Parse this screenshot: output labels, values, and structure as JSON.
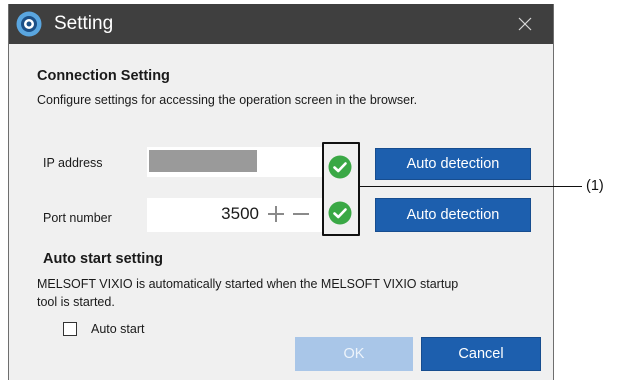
{
  "window": {
    "title": "Setting"
  },
  "connection": {
    "heading": "Connection Setting",
    "description": "Configure settings for accessing the operation screen in the browser.",
    "ip": {
      "label": "IP address",
      "value": "",
      "status_icon": "check-circle-icon",
      "button": "Auto detection"
    },
    "port": {
      "label": "Port number",
      "value": "3500",
      "plus": "+",
      "minus": "−",
      "status_icon": "check-circle-icon",
      "button": "Auto detection"
    }
  },
  "auto_start": {
    "heading": "Auto start setting",
    "description_line1": "MELSOFT VIXIO is automatically started when the MELSOFT VIXIO startup",
    "description_line2": "tool is started.",
    "checkbox_label": "Auto start",
    "checked": false
  },
  "footer": {
    "ok_label": "OK",
    "cancel_label": "Cancel"
  },
  "annotation": {
    "label": "(1)"
  },
  "colors": {
    "titlebar": "#3f3f3f",
    "accent": "#1d5fae",
    "disabled": "#a9c6e8",
    "success": "#3aa845"
  }
}
